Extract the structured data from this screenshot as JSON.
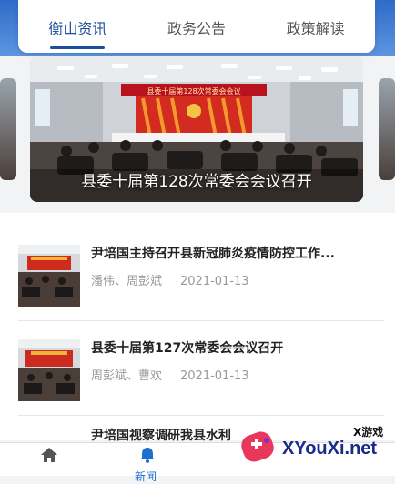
{
  "tabs": [
    {
      "label": "衡山资讯",
      "active": true
    },
    {
      "label": "政务公告",
      "active": false
    },
    {
      "label": "政策解读",
      "active": false
    }
  ],
  "banner": {
    "caption": "县委十届第128次常委会会议召开",
    "banner_sign": "县委十届第128次常委会会议"
  },
  "news": [
    {
      "title": "尹培国主持召开县新冠肺炎疫情防控工作...",
      "authors": "潘伟、周彭斌",
      "date": "2021-01-13"
    },
    {
      "title": "县委十届第127次常委会会议召开",
      "authors": "周彭斌、曹欢",
      "date": "2021-01-13"
    },
    {
      "title": "尹培国视察调研我县水利",
      "authors": "",
      "date": ""
    }
  ],
  "nav": {
    "items": [
      {
        "icon": "home-icon"
      },
      {
        "icon": "bell-icon",
        "label": "新闻"
      }
    ]
  },
  "watermark": {
    "small": "X游戏",
    "big": "XYouXi.net"
  },
  "colors": {
    "accent": "#1f4f9b",
    "topbar": "#2f6cc9",
    "active_nav": "#1f6fd0"
  }
}
